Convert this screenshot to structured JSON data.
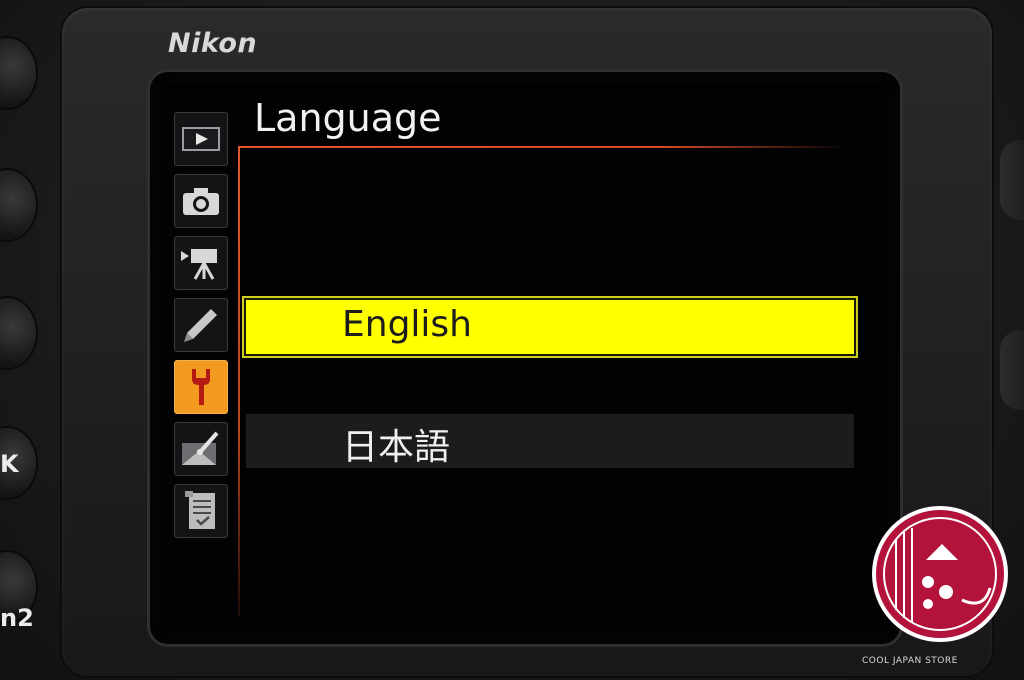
{
  "camera": {
    "brand": "Nikon",
    "side_labels": [
      "",
      "",
      "",
      "K",
      "n2"
    ]
  },
  "menu": {
    "title": "Language",
    "tabs": [
      {
        "name": "playback-menu",
        "icon": "play-icon",
        "active": false
      },
      {
        "name": "photo-shooting-menu",
        "icon": "camera-icon",
        "active": false
      },
      {
        "name": "movie-shooting-menu",
        "icon": "movie-camera-icon",
        "active": false
      },
      {
        "name": "custom-settings-menu",
        "icon": "pencil-icon",
        "active": false
      },
      {
        "name": "setup-menu",
        "icon": "wrench-icon",
        "active": true
      },
      {
        "name": "retouch-menu",
        "icon": "retouch-brush-icon",
        "active": false
      },
      {
        "name": "my-menu",
        "icon": "checklist-icon",
        "active": false
      }
    ],
    "options": [
      {
        "label": "English",
        "selected": true
      },
      {
        "label": "日本語",
        "selected": false
      }
    ]
  },
  "watermark": {
    "text": "COOL JAPAN STORE"
  },
  "colors": {
    "highlight": "#ffff00",
    "active_tab": "#f29a20",
    "accent_rule": "#e0572a",
    "watermark": "#b3123a"
  }
}
